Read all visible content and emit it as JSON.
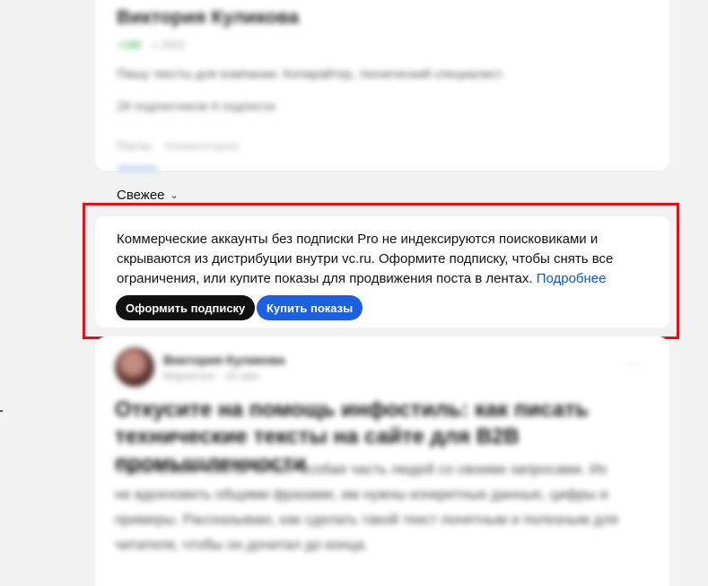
{
  "profile": {
    "name": "Виктория Куликова",
    "meta_badge": "+189",
    "meta_date": "с 2022",
    "description": "Пишу тексты для компании. Копирайтер, технический специалист.",
    "stats": "28 подписчиков   6 подписок",
    "tags_label": "Посты",
    "tags_value": "Комментарии"
  },
  "feed": {
    "sort_label": "Свежее"
  },
  "notice": {
    "text": "Коммерческие аккаунты без подписки Pro не индексируются поисковиками и скрываются из дистрибуции внутри vc.ru. Оформите подписку, чтобы снять все ограничения, или купите показы для продвижения поста в лентах.",
    "link_label": "Подробнее",
    "subscribe_label": "Оформить подписку",
    "buy_label": "Купить показы"
  },
  "post": {
    "author": "Виктория Куликова",
    "subtitle": "Маркетинг · 15 мин",
    "more": "···",
    "title": "Откусите на помощь инфостиль: как писать технические тексты на сайте для B2B промышленности",
    "excerpt": "Технические тексты читает особая часть людей со своими запросами. Их не вдохновить общими фразами, им нужны конкретные данные, цифры и примеры. Рассказываю, как сделать такой текст понятным и полезным для читателя, чтобы он дочитал до конца."
  },
  "colors": {
    "highlight": "#ea0f10",
    "link": "#0b57d0",
    "primary_button": "#111111",
    "accent_button": "#1c5fe0"
  }
}
